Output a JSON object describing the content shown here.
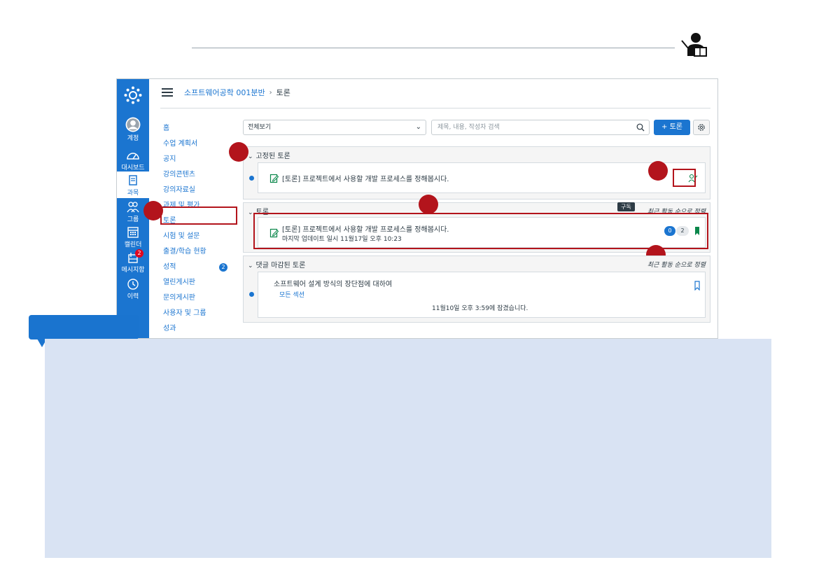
{
  "header": {
    "teacher_icon": "teacher-lectern-icon"
  },
  "gnav": {
    "logo": "canvas-logo-icon",
    "items": [
      {
        "label": "계정",
        "icon": "account-avatar-icon"
      },
      {
        "label": "대시보드",
        "icon": "dashboard-icon"
      },
      {
        "label": "과목",
        "icon": "courses-icon",
        "active": true
      },
      {
        "label": "그룹",
        "icon": "groups-icon"
      },
      {
        "label": "캘린더",
        "icon": "calendar-icon"
      },
      {
        "label": "메시지함",
        "icon": "inbox-icon",
        "badge": "2"
      },
      {
        "label": "이력",
        "icon": "history-clock-icon"
      }
    ]
  },
  "breadcrumb": {
    "course": "소프트웨어공학 001분반",
    "separator": "›",
    "current": "토론"
  },
  "course_nav": {
    "items": [
      {
        "label": "홈"
      },
      {
        "label": "수업 계획서"
      },
      {
        "label": "공지"
      },
      {
        "label": "강의콘텐츠"
      },
      {
        "label": "강의자료실"
      },
      {
        "label": "과제 및 평가"
      },
      {
        "label": "토론"
      },
      {
        "label": "시험 및 설문"
      },
      {
        "label": "출결/학습 현황"
      },
      {
        "label": "성적",
        "badge": "2"
      },
      {
        "label": "열린게시판"
      },
      {
        "label": "문의게시판"
      },
      {
        "label": "사용자 및 그룹"
      },
      {
        "label": "성과"
      }
    ]
  },
  "toolbar": {
    "filter_value": "전체보기",
    "search_placeholder": "제목, 내용, 작성자 검색",
    "add_button": "+ 토론"
  },
  "sections": {
    "pinned": {
      "title": "고정된 토론",
      "topic_title": "[토론] 프로젝트에서 사용할 개발 프로세스를 정해봅시다."
    },
    "discussions": {
      "title": "토론",
      "sort_label": "최근 활동 순으로 정렬",
      "tooltip": "구독",
      "topic_title": "[토론] 프로젝트에서 사용할 개발 프로세스를 정해봅시다.",
      "topic_sub": "마지막 업데이트 일시 11월17일 오후 10:23",
      "unread_count": "0",
      "reply_count": "2"
    },
    "closed": {
      "title": "댓글 마감된 토론",
      "sort_label": "최근 활동 순으로 정렬",
      "topic_title": "소프트웨어 설계 방식의 장단점에 대하여",
      "topic_section": "모든 섹션",
      "topic_closed": "11월10일 오후 3:59에 잠겼습니다."
    }
  },
  "colors": {
    "brand": "#1b75d0",
    "highlight": "#b3141c",
    "note_panel": "#d9e3f3",
    "success": "#0b874b"
  }
}
